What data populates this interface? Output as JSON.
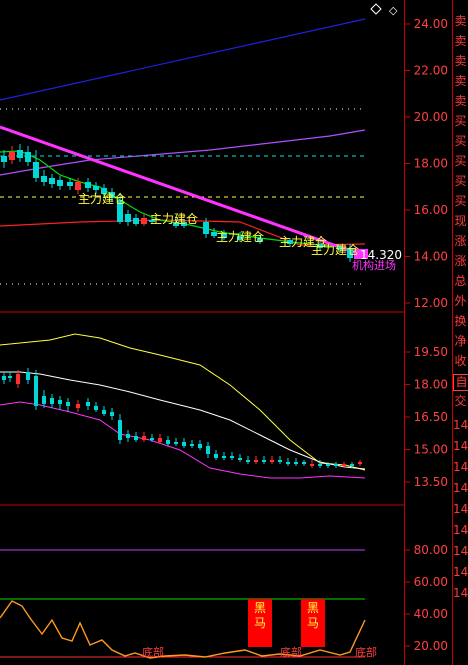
{
  "colors": {
    "background": "#000000",
    "axis_red": "#cc0000",
    "label_red": "#ff4040",
    "candle_up": "#ff3030",
    "candle_down": "#00d8d8",
    "blue_line": "#2020e0",
    "magenta_line": "#ff33ff",
    "violet_line": "#b050ff",
    "yellow_line": "#ffff40",
    "cyan_dash": "#00e0e0",
    "green_line": "#00dd00",
    "orange_line": "#ff9a20",
    "signal_red": "#ff0000"
  },
  "top_panel": {
    "diamond_icon": "diamond-outline-icon",
    "y_ticks": [
      "24.00",
      "22.00",
      "20.00",
      "18.00",
      "16.00",
      "14.00",
      "12.00"
    ],
    "price_tag": "14.320",
    "signals": [
      "主力建仓",
      "主力建仓",
      "主力建仓",
      "主力建仓",
      "主力建仓"
    ],
    "entry_label": "机构进场"
  },
  "mid_panel": {
    "y_ticks": [
      "19.50",
      "18.00",
      "16.50",
      "15.00",
      "13.50"
    ]
  },
  "bottom_panel": {
    "y_ticks": [
      "80.00",
      "60.00",
      "40.00",
      "20.00"
    ],
    "black_horse_labels": [
      "黑\n马",
      "黑\n马"
    ],
    "bottom_labels": [
      "底部",
      "底部",
      "底部"
    ]
  },
  "side_column": {
    "chars": [
      "卖",
      "卖",
      "卖",
      "卖",
      "卖",
      "买",
      "买",
      "买",
      "买",
      "买",
      "现",
      "涨",
      "涨",
      "总",
      "外",
      "换",
      "净",
      "收",
      "自",
      "交",
      "14",
      "14",
      "14",
      "14",
      "14",
      "14",
      "14",
      "14",
      "14"
    ]
  }
}
